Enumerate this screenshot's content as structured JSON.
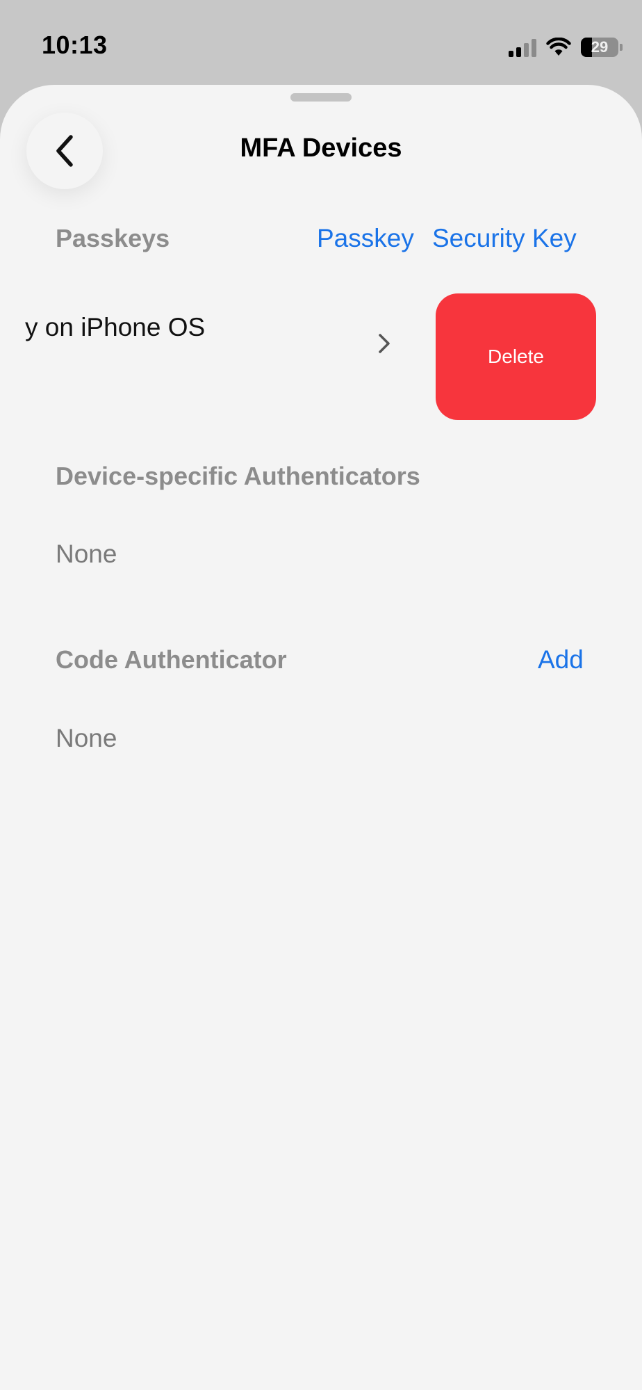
{
  "status_bar": {
    "time": "10:13",
    "battery": "29",
    "icons": [
      "signal-icon",
      "wifi-icon",
      "battery-icon"
    ]
  },
  "header": {
    "title": "MFA Devices",
    "back_icon": "chevron-left-icon"
  },
  "passkeys": {
    "section_title": "Passkeys",
    "actions": [
      "Passkey",
      "Security Key"
    ],
    "items": [
      {
        "name": "y on iPhone OS",
        "delete_label": "Delete",
        "chevron_icon": "chevron-right-icon"
      }
    ]
  },
  "device_authenticators": {
    "section_title": "Device-specific Authenticators",
    "empty_text": "None"
  },
  "code_authenticator": {
    "section_title": "Code Authenticator",
    "action": "Add",
    "empty_text": "None"
  },
  "colors": {
    "accent": "#1a73e8",
    "delete": "#f7353d",
    "section_header": "#8c8c8c",
    "sheet_bg": "#f4f4f4"
  }
}
